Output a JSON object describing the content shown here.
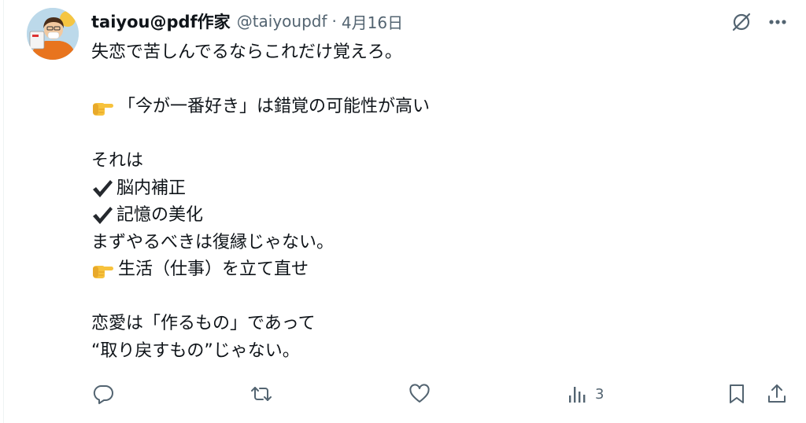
{
  "tweet": {
    "display_name": "taiyou@pdf作家",
    "handle": "@taiyoupdf",
    "separator": "·",
    "date": "4月16日",
    "lines": [
      {
        "emoji": "",
        "text": "失恋で苦しんでるならこれだけ覚えろ。"
      },
      {
        "emoji": "",
        "text": ""
      },
      {
        "emoji": "backhand-index-pointing-right",
        "text": "「今が一番好き」は錯覚の可能性が高い"
      },
      {
        "emoji": "",
        "text": ""
      },
      {
        "emoji": "",
        "text": "それは"
      },
      {
        "emoji": "heavy-check-mark",
        "text": "脳内補正"
      },
      {
        "emoji": "heavy-check-mark",
        "text": "記憶の美化"
      },
      {
        "emoji": "",
        "text": "まずやるべきは復縁じゃない。"
      },
      {
        "emoji": "backhand-index-pointing-right",
        "text": "生活（仕事）を立て直せ"
      },
      {
        "emoji": "",
        "text": ""
      },
      {
        "emoji": "",
        "text": "恋愛は「作るもの」であって"
      },
      {
        "emoji": "",
        "text": "“取り戻すもの”じゃない。"
      }
    ],
    "views": "3"
  },
  "icons": {
    "top_right": [
      "grok-icon",
      "more-icon"
    ],
    "actions": [
      "reply-icon",
      "retweet-icon",
      "like-icon",
      "views-icon",
      "bookmark-icon",
      "share-icon"
    ]
  },
  "colors": {
    "text": "#0f1419",
    "secondary": "#536471",
    "divider": "#eff3f4"
  }
}
